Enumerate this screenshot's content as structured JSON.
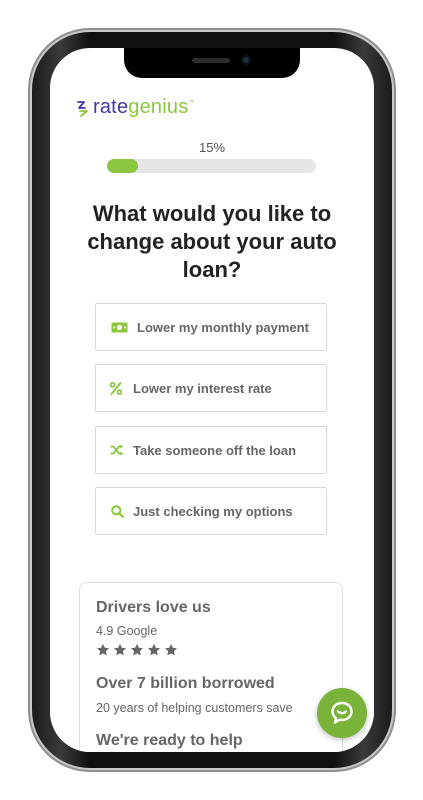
{
  "brand": {
    "name_rate": "rate",
    "name_genius": "genius",
    "trademark": "™",
    "color_primary": "#3f3aa8",
    "color_accent": "#8cc63f"
  },
  "progress": {
    "label": "15%",
    "value": 0.15
  },
  "question": "What would you like to change about your auto loan?",
  "options": [
    {
      "label": "Lower my monthly payment",
      "icon": "money-icon"
    },
    {
      "label": "Lower my interest rate",
      "icon": "percent-icon"
    },
    {
      "label": "Take someone off the loan",
      "icon": "shuffle-icon"
    },
    {
      "label": "Just checking my options",
      "icon": "search-icon"
    }
  ],
  "reviews": {
    "heading": "Drivers love us",
    "rating_text": "4.9 Google",
    "stars": 5,
    "stat_heading": "Over 7 billion borrowed",
    "stat_text": "20 years of helping customers save",
    "ready_heading": "We're ready to help"
  },
  "chat": {
    "icon": "chat-bubble-icon"
  }
}
